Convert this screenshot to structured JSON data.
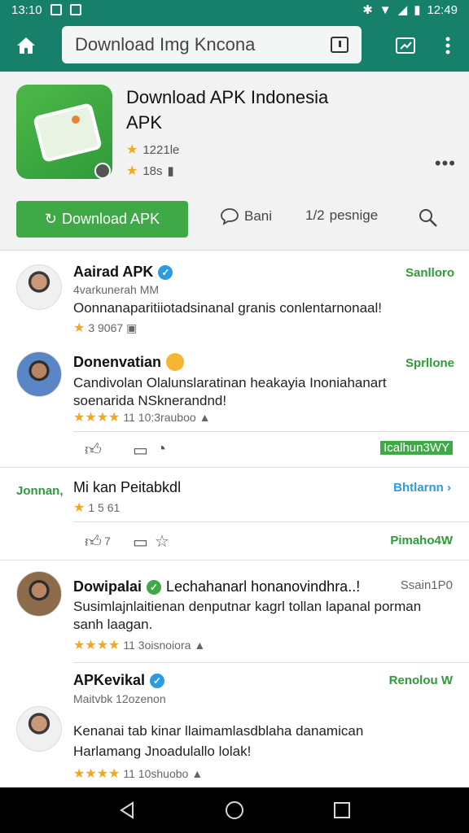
{
  "status_bar": {
    "time_left": "13:10",
    "time_right": "12:49"
  },
  "browser": {
    "url_text": "Download Img Kncona",
    "home_icon": "home-icon",
    "tabs_icon": "tabs-icon",
    "menu_icon": "overflow-menu-icon"
  },
  "app": {
    "title_line1": "Download APK Indonesia",
    "title_line2": "APK",
    "rating": "1221le",
    "downloads": "18s",
    "download_button": "Download APK",
    "action_share": "Bani",
    "action_prestige": "pesnige",
    "action_prestige_prefix": "1/2"
  },
  "posts": [
    {
      "name": "Aairad APK",
      "sub": "4varkunerah MM",
      "text": [
        "Oonnanaparitiiotadsinanal  granis conlentarnonaal!"
      ],
      "meta": "3 9067",
      "tag": "Sanlloro"
    },
    {
      "name": "Donenvatian",
      "text": [
        "Candivolan Olalunslaratinan heakayia Inoniahanart",
        "soenarida NSknerandnd!"
      ],
      "meta": "11 10:3rauboo",
      "tag": "Sprllone"
    },
    {
      "row_tag": "Icalhun3WY"
    },
    {
      "left_label": "Jonnan,",
      "name": "Mi kan Peitabkdl",
      "meta": "1 5 61",
      "tag": "Bhtlarnn"
    },
    {
      "row_tag": "Pimaho4W",
      "like_count": "7"
    },
    {
      "name": "Dowipalai",
      "name_rest": "Lechahanarl honanovindhra..!",
      "text": [
        "Susimlajnlaitienan denputnar kagrl tollan lapanal porman",
        "sanh laagan."
      ],
      "meta": "11 3oisnoiora",
      "tag": "Ssain1P0"
    },
    {
      "name": "APKevikal",
      "sub": "Maitvbk 12ozenon",
      "text": [
        "Kenanai tab kinar llaimamlasdblaha danamican",
        "Harlamang Jnoadulallo lolak!"
      ],
      "meta": "11 10shuobo",
      "tag": "Renolou W"
    }
  ]
}
